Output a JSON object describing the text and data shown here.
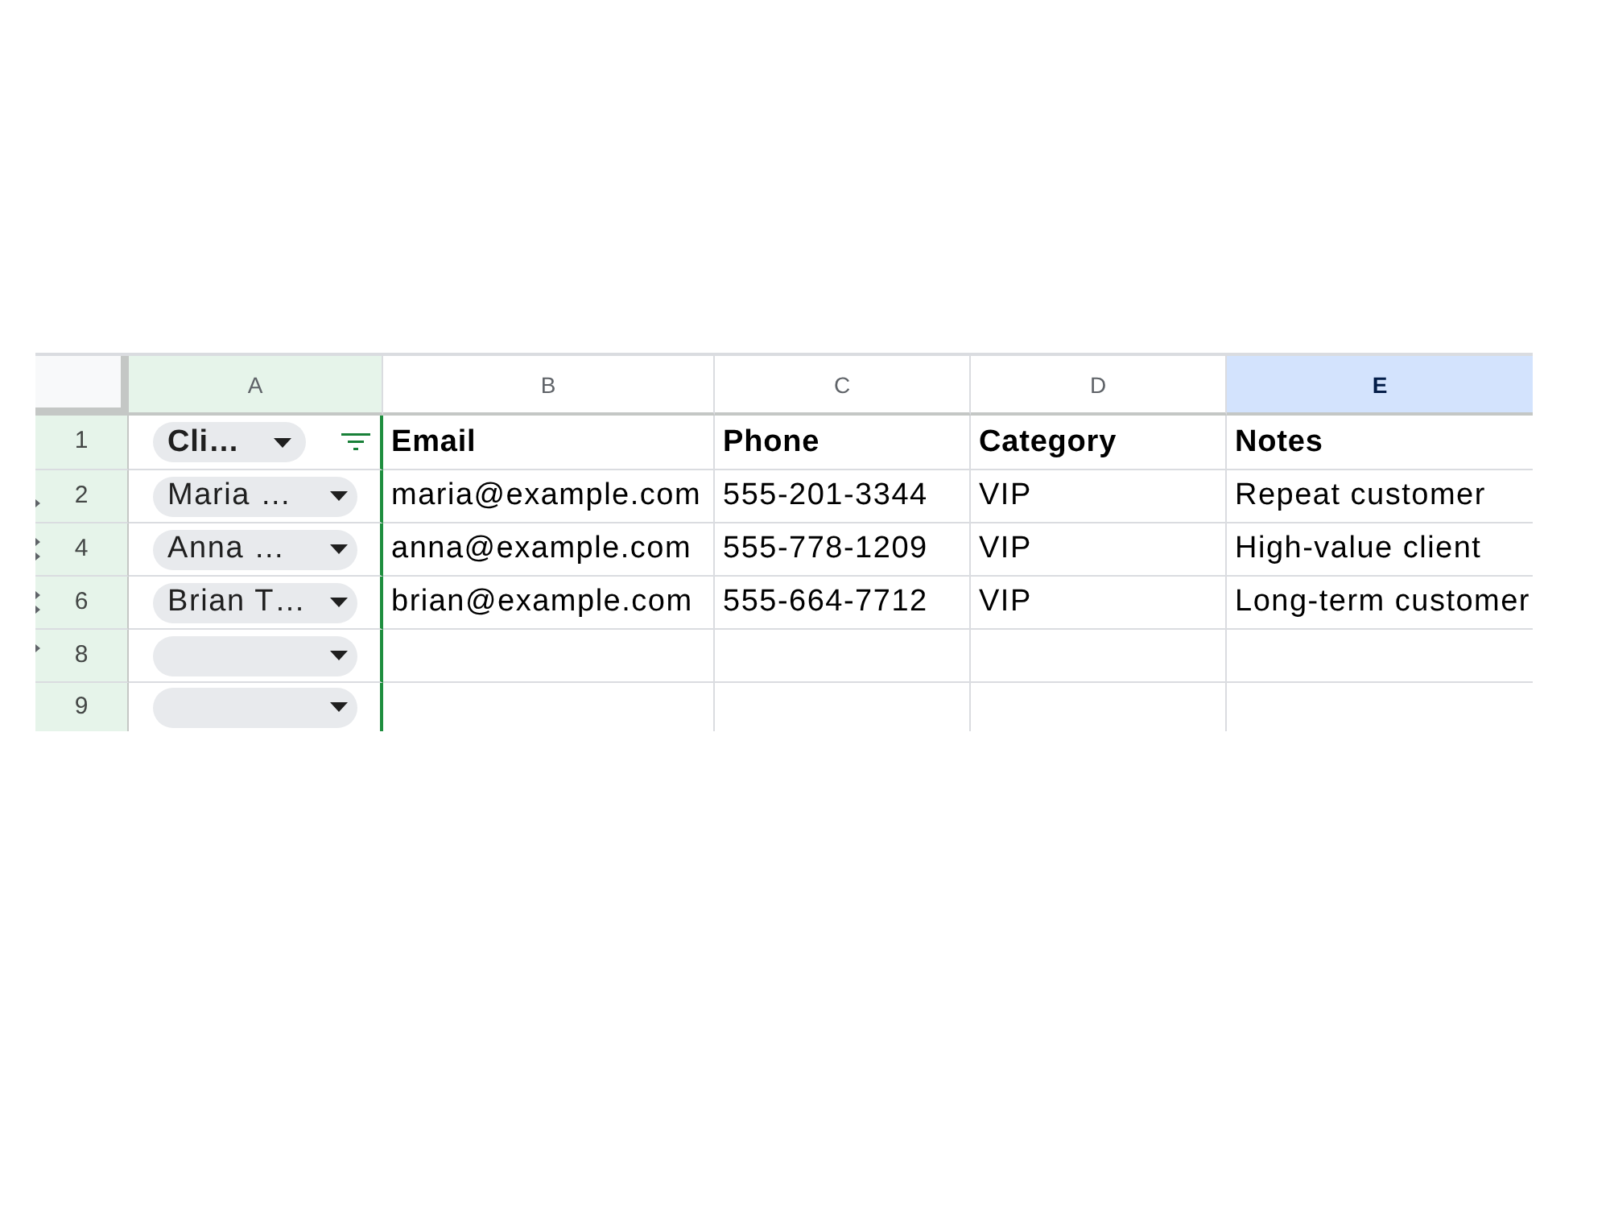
{
  "sheet": {
    "filter_active": true,
    "columns": [
      {
        "letter": "A",
        "filtered": true,
        "selected": false
      },
      {
        "letter": "B",
        "filtered": false,
        "selected": false
      },
      {
        "letter": "C",
        "filtered": false,
        "selected": false
      },
      {
        "letter": "D",
        "filtered": false,
        "selected": false
      },
      {
        "letter": "E",
        "filtered": false,
        "selected": true
      }
    ],
    "rows": [
      {
        "number": "1",
        "kind": "header",
        "hidden_above": false,
        "hidden_below": false,
        "a_cell": {
          "kind": "chip",
          "value": "Cli…"
        },
        "filter_button": true,
        "cells": [
          "Email",
          "Phone",
          "Category",
          "Notes"
        ]
      },
      {
        "number": "2",
        "kind": "data",
        "hidden_above": false,
        "hidden_below": true,
        "a_cell": {
          "kind": "chip",
          "value": "Maria …"
        },
        "filter_button": false,
        "cells": [
          "maria@example.com",
          "555-201-3344",
          "VIP",
          "Repeat customer"
        ]
      },
      {
        "number": "4",
        "kind": "data",
        "hidden_above": true,
        "hidden_below": true,
        "a_cell": {
          "kind": "chip",
          "value": "Anna …"
        },
        "filter_button": false,
        "cells": [
          "anna@example.com",
          "555-778-1209",
          "VIP",
          "High-value client"
        ]
      },
      {
        "number": "6",
        "kind": "data",
        "hidden_above": true,
        "hidden_below": true,
        "a_cell": {
          "kind": "chip",
          "value": "Brian T…"
        },
        "filter_button": false,
        "cells": [
          "brian@example.com",
          "555-664-7712",
          "VIP",
          "Long-term customer"
        ]
      },
      {
        "number": "8",
        "kind": "data",
        "hidden_above": true,
        "hidden_below": false,
        "a_cell": {
          "kind": "chip"
        },
        "filter_button": false
      },
      {
        "number": "9",
        "kind": "data",
        "hidden_above": false,
        "hidden_below": false,
        "a_cell": {
          "kind": "chip"
        },
        "filter_button": false
      }
    ]
  }
}
